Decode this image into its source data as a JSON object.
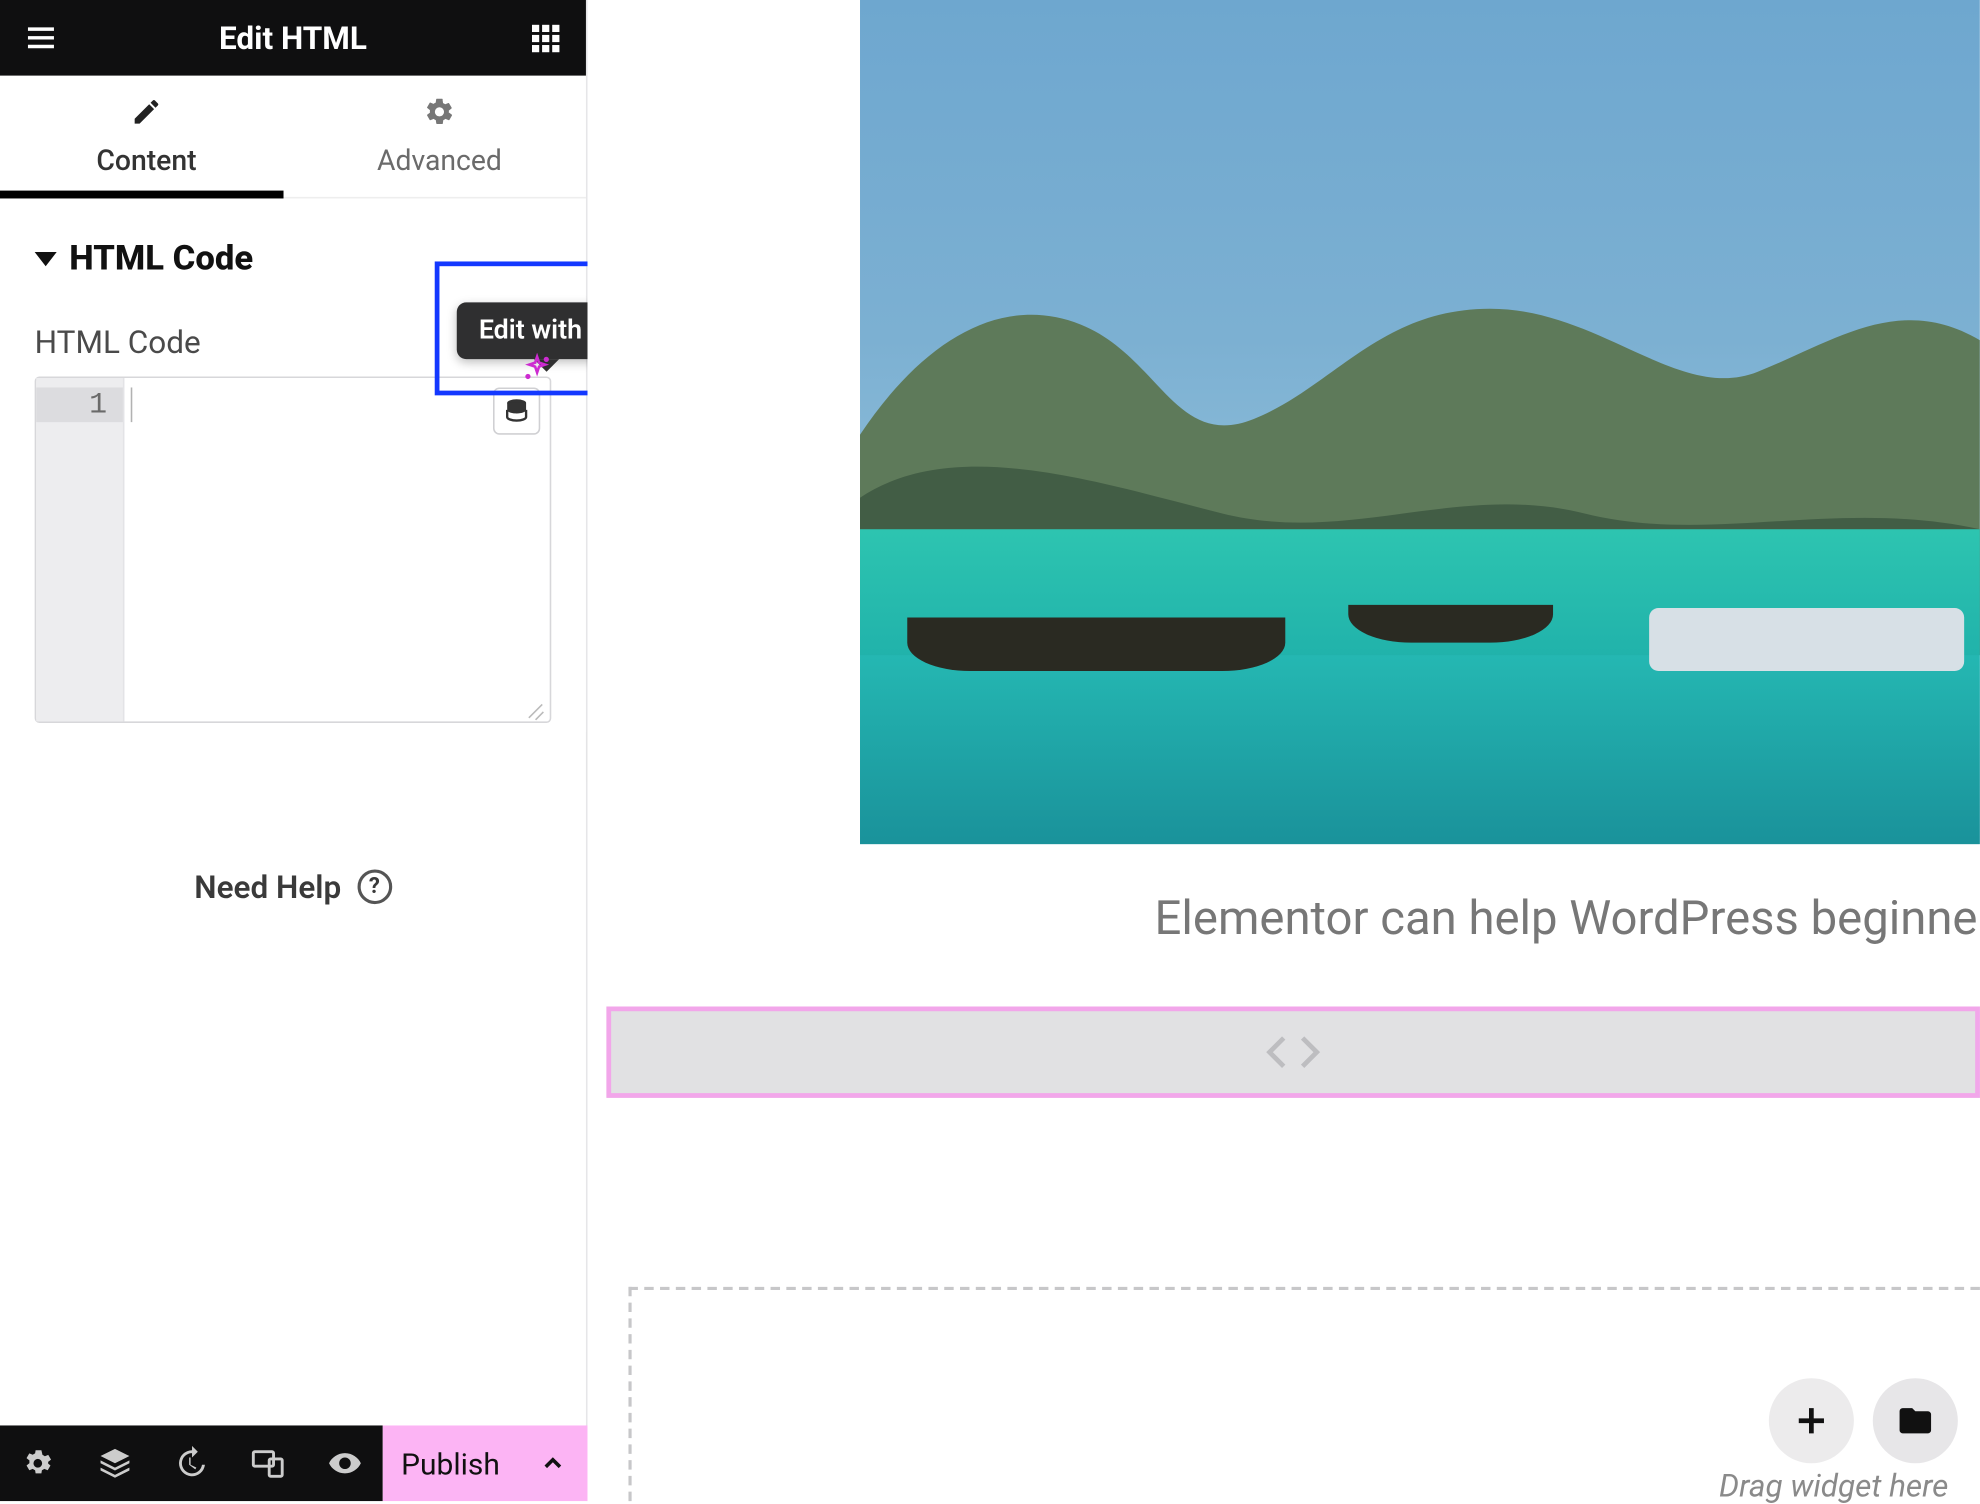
{
  "header": {
    "title": "Edit HTML"
  },
  "tabs": {
    "content": "Content",
    "advanced": "Advanced",
    "active": "content"
  },
  "section": {
    "title": "HTML Code"
  },
  "field": {
    "label": "HTML Code"
  },
  "tooltip": {
    "edit_ai": "Edit with AI"
  },
  "editor": {
    "line_number": "1"
  },
  "help": {
    "label": "Need Help"
  },
  "footer": {
    "publish": "Publish"
  },
  "preview": {
    "caption": "Elementor can help WordPress beginners make beautif",
    "footnote": "Drag widget here"
  }
}
